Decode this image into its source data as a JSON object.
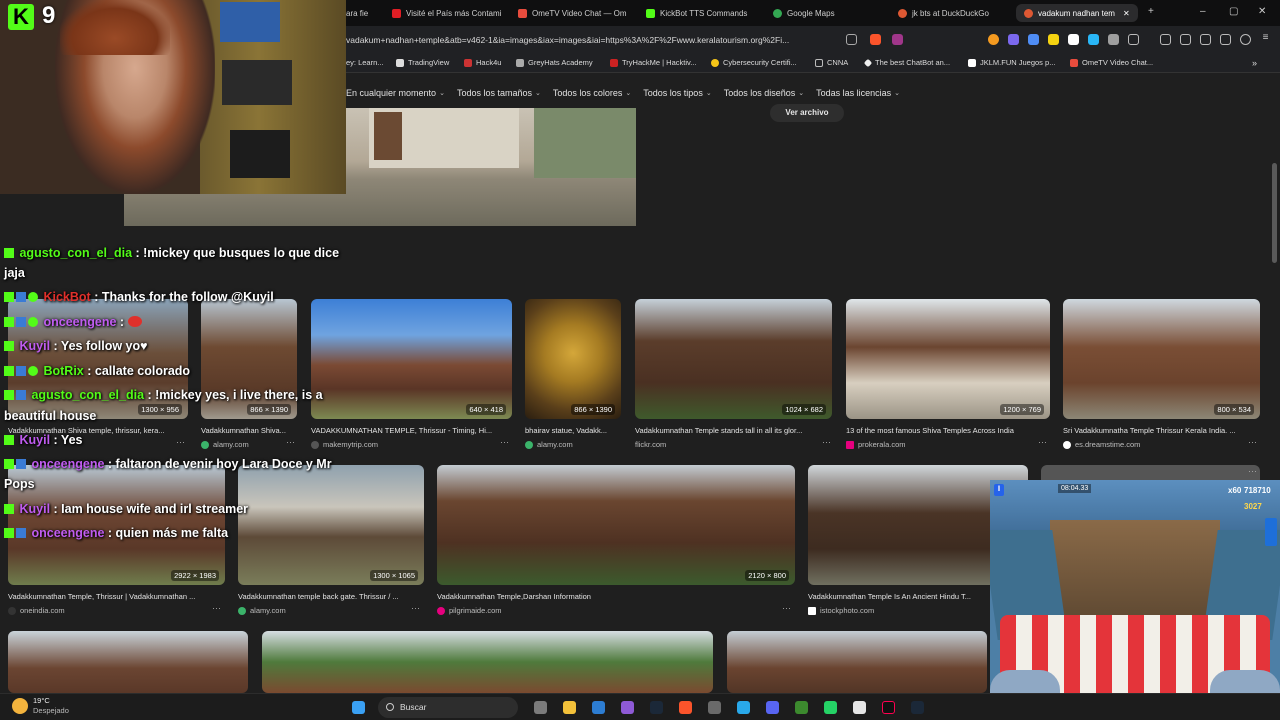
{
  "tabs": [
    {
      "label": "ara fie",
      "color": "#888"
    },
    {
      "label": "Visité el País más Contami",
      "color": "#e01e25"
    },
    {
      "label": "OmeTV Video Chat — Om",
      "color": "#e84c3d"
    },
    {
      "label": "KickBot TTS Commands",
      "color": "#53fc18"
    },
    {
      "label": "Google Maps",
      "color": "#34a853"
    },
    {
      "label": "jk bts at DuckDuckGo",
      "color": "#de5833"
    },
    {
      "label": "vadakum nadhan tem",
      "color": "#de5833"
    }
  ],
  "tab_close": "✕",
  "new_tab": "+",
  "window_controls": {
    "minimize": "–",
    "maximize": "▢",
    "close": "✕"
  },
  "url": "vadakum+nadhan+temple&atb=v462-1&ia=images&iax=images&iai=https%3A%2F%2Fwww.keralatourism.org%2Fi...",
  "bookmarks": [
    {
      "label": "ey: Learn...",
      "color": "#888"
    },
    {
      "label": "TradingView",
      "color": "#ddd"
    },
    {
      "label": "Hack4u",
      "color": "#c33"
    },
    {
      "label": "GreyHats Academy",
      "color": "#aaa"
    },
    {
      "label": "TryHackMe | Hacktiv...",
      "color": "#c22"
    },
    {
      "label": "Cybersecurity Certifi...",
      "color": "#f5c518"
    },
    {
      "label": "CNNA",
      "color": "#bbb"
    },
    {
      "label": "The best ChatBot an...",
      "color": "#eee"
    },
    {
      "label": "JKLM.FUN Juegos p...",
      "color": "#fff"
    },
    {
      "label": "OmeTV Video Chat...",
      "color": "#e84c3d"
    }
  ],
  "filters": [
    "En cualquier momento",
    "Todos los tamaños",
    "Todos los colores",
    "Todos los tipos",
    "Todos los diseños",
    "Todas las licencias"
  ],
  "ver_archivo": "Ver archivo",
  "results_row1": [
    {
      "caption": "Vadakkumnathan Shiva temple, thrissur, kera...",
      "source": "alamy.com",
      "dims": "1300 × 956"
    },
    {
      "caption": "Vadakkumnathan Shiva...",
      "source": "alamy.com",
      "dims": "866 × 1390"
    },
    {
      "caption": "VADAKKUMNATHAN TEMPLE, Thrissur - Timing, Hi...",
      "source": "makemytrip.com",
      "dims": "640 × 418"
    },
    {
      "caption": "bhairav statue, Vadakk...",
      "source": "alamy.com",
      "dims": "866 × 1390"
    },
    {
      "caption": "Vadakkumnathan Temple stands tall in all its glor...",
      "source": "flickr.com",
      "dims": "1024 × 682"
    },
    {
      "caption": "13 of the most famous Shiva Temples Across India",
      "source": "prokerala.com",
      "dims": "1200 × 769"
    },
    {
      "caption": "Sri Vadakkumnatha Temple Thrissur Kerala India. ...",
      "source": "es.dreamstime.com",
      "dims": "800 × 534"
    }
  ],
  "results_row2": [
    {
      "caption": "Vadakkumnathan Temple, Thrissur | Vadakkumnathan ...",
      "source": "oneindia.com",
      "dims": "2922 × 1983"
    },
    {
      "caption": "Vadakkumnathan temple back gate. Thrissur / ...",
      "source": "alamy.com",
      "dims": "1300 × 1065"
    },
    {
      "caption": "Vadakkumnathan Temple,Darshan Information",
      "source": "pilgrimaide.com",
      "dims": "2120 × 800"
    },
    {
      "caption": "Vadakkumnathan Temple Is An Ancient Hindu T...",
      "source": "istockphoto.com",
      "dims": "10"
    }
  ],
  "chat": [
    {
      "user": "agusto_con_el_dia",
      "text": " : !mickey que busques lo que dice"
    },
    {
      "user": "",
      "text": "jaja"
    },
    {
      "user": "KickBot",
      "text": " : Thanks for the follow @Kuyil"
    },
    {
      "user": "onceengene",
      "text": " : "
    },
    {
      "user": "Kuyil",
      "text": " : Yes follow yo♥"
    },
    {
      "user": "BotRix",
      "text": " : callate colorado"
    },
    {
      "user": "agusto_con_el_dia",
      "text": " : !mickey yes, i live there, is a"
    },
    {
      "user": "",
      "text": "beautiful house"
    },
    {
      "user": "Kuyil",
      "text": " : Yes"
    },
    {
      "user": "onceengene",
      "text": " : faltaron de venir hoy Lara Doce y Mr"
    },
    {
      "user": "",
      "text": "Pops"
    },
    {
      "user": "Kuyil",
      "text": " : Iam house wife and irl streamer"
    },
    {
      "user": "onceengene",
      "text": " : quien más me falta"
    }
  ],
  "kick_logo": "K",
  "viewer_count": "9",
  "game_hud": {
    "timer": "08:04.33",
    "multiplier": "x60",
    "score": "718710",
    "coins": "3027"
  },
  "taskbar": {
    "weather_temp": "19°C",
    "weather_desc": "Despejado",
    "search": "Buscar"
  },
  "colors": {
    "accent": "#53fc18",
    "kick_green": "#53fc18",
    "bg": "#1f1f1f"
  }
}
